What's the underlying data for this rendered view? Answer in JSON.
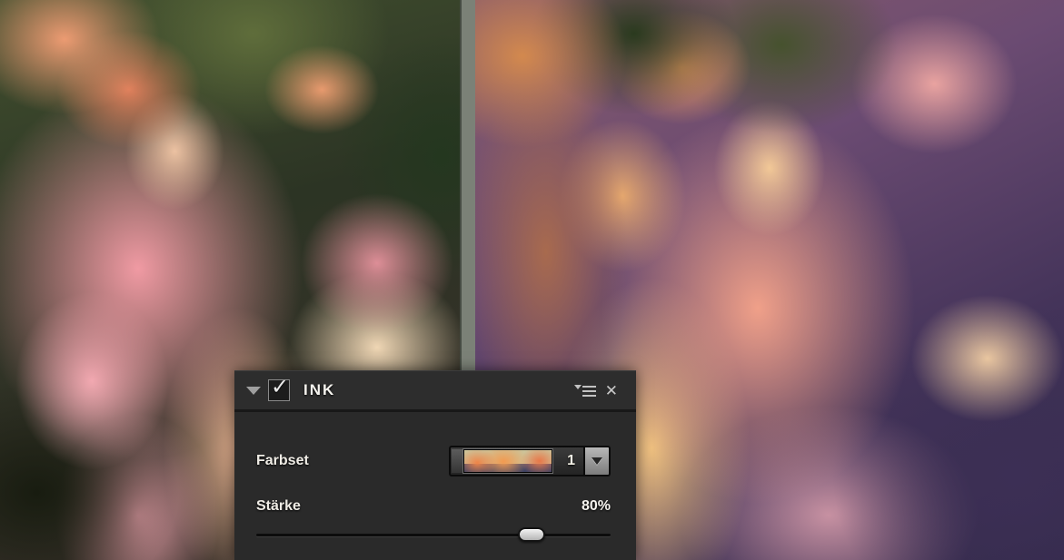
{
  "panel": {
    "title": "INK",
    "checkbox": {
      "checked": true
    },
    "icons": {
      "check": "✓",
      "close": "✕",
      "collapse": "▼",
      "menu": "≡",
      "dropdown_arrow": "▼"
    },
    "farbset": {
      "label": "Farbset",
      "value": "1"
    },
    "staerke": {
      "label": "Stärke",
      "value_label": "80%",
      "value_percent": 80
    }
  },
  "comparison": {
    "divider_color": "#7b8177"
  },
  "colors": {
    "panel_bg": "#2a2a2a",
    "panel_header_bg": "#2d2d2d",
    "panel_text": "#efece5"
  }
}
